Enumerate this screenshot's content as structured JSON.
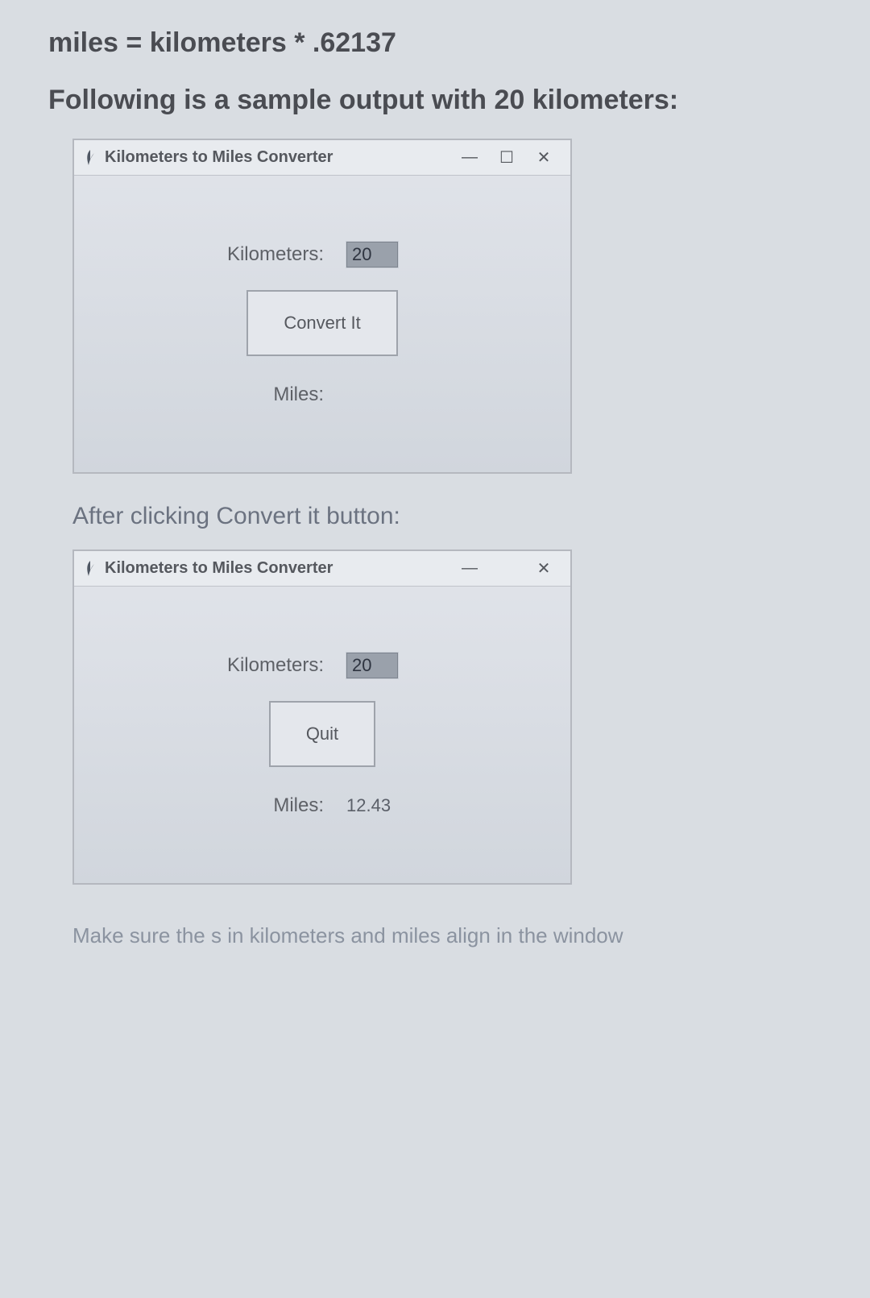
{
  "doc": {
    "formula": "miles = kilometers * .62137",
    "sample_intro": "Following is a sample output with 20 kilometers:",
    "after_caption": "After clicking Convert it button:",
    "footnote": "Make sure the s in kilometers and miles align in the window"
  },
  "window_before": {
    "title": "Kilometers to Miles Converter",
    "labels": {
      "km": "Kilometers:",
      "miles": "Miles:"
    },
    "km_value": "20",
    "miles_value": "",
    "button_label": "Convert It",
    "controls": {
      "min": "—",
      "max": "☐",
      "close": "✕"
    }
  },
  "window_after": {
    "title": "Kilometers to Miles Converter",
    "labels": {
      "km": "Kilometers:",
      "miles": "Miles:"
    },
    "km_value": "20",
    "miles_value": "12.43",
    "button_label": "Quit",
    "controls": {
      "min": "—",
      "max": "",
      "close": "✕"
    }
  }
}
